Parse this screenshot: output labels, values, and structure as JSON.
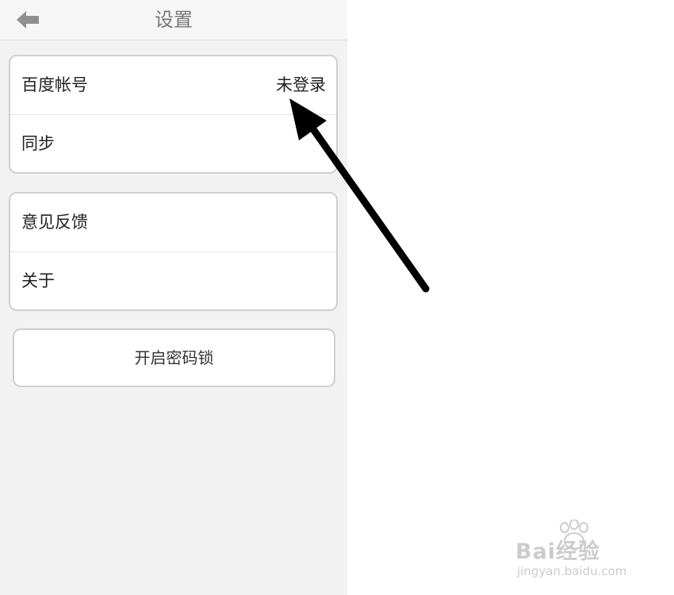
{
  "navbar": {
    "title": "设置",
    "back_icon": "back-arrow-icon"
  },
  "groups": [
    {
      "rows": [
        {
          "label": "百度帐号",
          "value": "未登录"
        },
        {
          "label": "同步"
        }
      ]
    },
    {
      "rows": [
        {
          "label": "意见反馈"
        },
        {
          "label": "关于"
        }
      ]
    }
  ],
  "lock_button": {
    "label": "开启密码锁"
  },
  "annotation": {
    "icon": "pointer-arrow-icon",
    "color": "#000000"
  },
  "watermark": {
    "logo_text": "Bai经验",
    "url": "jingyan.baidu.com"
  },
  "colors": {
    "background": "#f2f2f2",
    "card": "#ffffff",
    "border": "#cfcfcf",
    "title": "#777777"
  }
}
